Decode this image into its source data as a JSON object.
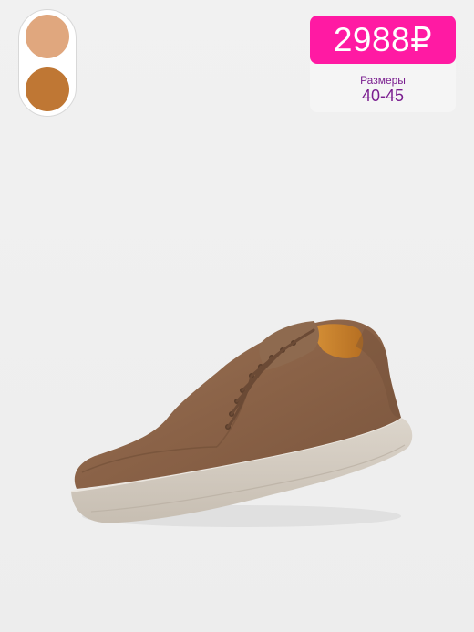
{
  "colors": {
    "price_bg": "#ff1aa3",
    "price_text": "#ffffff",
    "sizes_text": "#7a1e8f",
    "swatch_light": "#e0a77e",
    "swatch_dark": "#bf7734"
  },
  "swatches": [
    {
      "color": "#e0a77e"
    },
    {
      "color": "#bf7734"
    }
  ],
  "price": {
    "label": "2988₽"
  },
  "sizes": {
    "label": "Размеры",
    "value": "40-45"
  }
}
